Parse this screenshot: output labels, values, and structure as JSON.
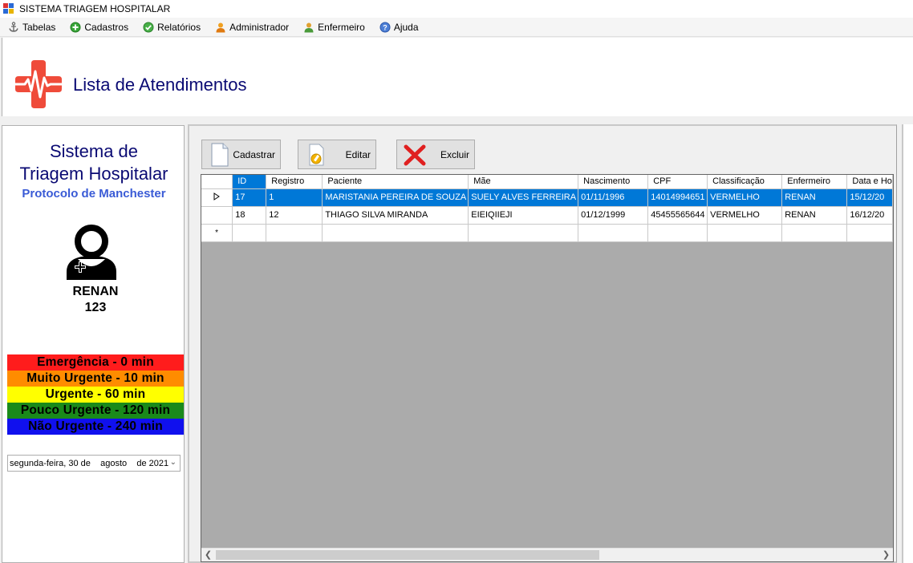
{
  "window": {
    "title": "SISTEMA TRIAGEM HOSPITALAR"
  },
  "menu": [
    {
      "label": "Tabelas",
      "icon": "anchor-icon"
    },
    {
      "label": "Cadastros",
      "icon": "add-icon"
    },
    {
      "label": "Relatórios",
      "icon": "check-icon"
    },
    {
      "label": "Administrador",
      "icon": "user-icon"
    },
    {
      "label": "Enfermeiro",
      "icon": "nurse-icon"
    },
    {
      "label": "Ajuda",
      "icon": "help-icon"
    }
  ],
  "header": {
    "title": "Lista de Atendimentos"
  },
  "sidebar": {
    "system_title_line1": "Sistema de",
    "system_title_line2": "Triagem Hospitalar",
    "subtitle": "Protocolo de Manchester",
    "user_name": "RENAN",
    "user_id": "123",
    "legend": [
      {
        "label": "Emergência - 0 min",
        "color": "#ff1c1c"
      },
      {
        "label": "Muito Urgente - 10 min",
        "color": "#ff8c00"
      },
      {
        "label": "Urgente - 60 min",
        "color": "#ffff00"
      },
      {
        "label": "Pouco Urgente - 120 min",
        "color": "#1a8a1a"
      },
      {
        "label": "Não Urgente - 240 min",
        "color": "#1010ee"
      }
    ],
    "date": "segunda-feira, 30 de    agosto    de 2021"
  },
  "toolbar": {
    "cadastrar": "Cadastrar",
    "editar": "Editar",
    "excluir": "Excluir"
  },
  "grid": {
    "columns": [
      "ID",
      "Registro",
      "Paciente",
      "Mãe",
      "Nascimento",
      "CPF",
      "Classificação",
      "Enfermeiro",
      "Data e Ho"
    ],
    "rows": [
      [
        "17",
        "1",
        "MARISTANIA PEREIRA DE SOUZA",
        "SUELY ALVES FERREIRA",
        "01/11/1996",
        "14014994651",
        "VERMELHO",
        "RENAN",
        "15/12/20"
      ],
      [
        "18",
        "12",
        "THIAGO SILVA MIRANDA",
        "EIEIQIIEJI",
        "01/12/1999",
        "45455565644",
        "VERMELHO",
        "RENAN",
        "16/12/20"
      ]
    ],
    "new_row_marker": "*",
    "selected_row": 0
  }
}
